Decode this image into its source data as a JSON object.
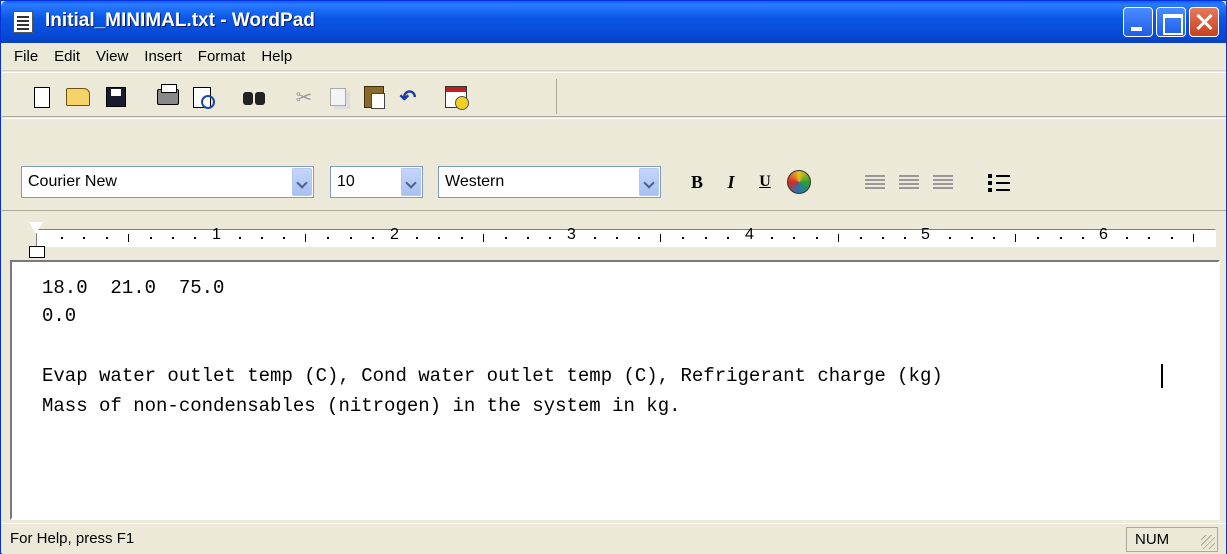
{
  "window": {
    "title": "Initial_MINIMAL.txt - WordPad"
  },
  "menu": [
    "File",
    "Edit",
    "View",
    "Insert",
    "Format",
    "Help"
  ],
  "toolbar": {
    "icons": [
      "new-icon",
      "open-icon",
      "save-icon",
      "print-icon",
      "print-preview-icon",
      "find-icon",
      "cut-icon",
      "copy-icon",
      "paste-icon",
      "undo-icon",
      "date-time-icon"
    ]
  },
  "format_bar": {
    "font": "Courier New",
    "size": "10",
    "script": "Western",
    "bold_label": "B",
    "italic_label": "I",
    "underline_label": "U"
  },
  "ruler": {
    "numbers": [
      "1",
      "2",
      "3",
      "4",
      "5",
      "6"
    ]
  },
  "document": {
    "lines": [
      "18.0  21.0  75.0",
      "0.0",
      "",
      "Evap water outlet temp (C), Cond water outlet temp (C), Refrigerant charge (kg)",
      "Mass of non-condensables (nitrogen) in the system in kg."
    ]
  },
  "status": {
    "help": "For Help, press F1",
    "num": "NUM"
  }
}
